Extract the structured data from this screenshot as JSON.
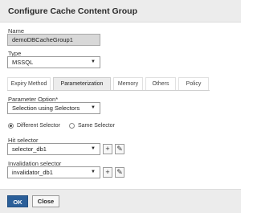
{
  "dialog": {
    "title": "Configure Cache Content Group"
  },
  "name": {
    "label": "Name",
    "value": "demoDBCacheGroup1"
  },
  "type": {
    "label": "Type",
    "value": "MSSQL"
  },
  "tabs": [
    {
      "label": "Expiry Method"
    },
    {
      "label": "Parameterization"
    },
    {
      "label": "Memory"
    },
    {
      "label": "Others"
    },
    {
      "label": "Policy"
    }
  ],
  "active_tab": "Parameterization",
  "parameter_option": {
    "label": "Parameter Option*",
    "value": "Selection using Selectors"
  },
  "radios": [
    {
      "label": "Different Selector",
      "checked": true
    },
    {
      "label": "Same Selector",
      "checked": false
    }
  ],
  "hit_selector": {
    "label": "Hit selector",
    "value": "selector_db1"
  },
  "invalidation_selector": {
    "label": "Invalidation selector",
    "value": "invalidator_db1"
  },
  "buttons": {
    "ok": "OK",
    "close": "Close",
    "add": "+",
    "edit": "✎"
  },
  "colors": {
    "primary": "#2b5f99",
    "header_bg": "#ececec"
  },
  "icons": {
    "dropdown": "caret-down-icon",
    "add": "plus-icon",
    "edit": "pencil-icon"
  }
}
